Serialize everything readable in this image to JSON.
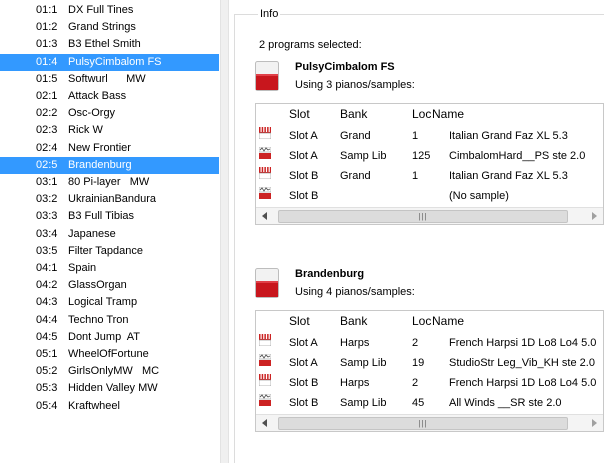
{
  "programs": [
    {
      "num": "01:1",
      "name": "DX Full Tines",
      "selected": false
    },
    {
      "num": "01:2",
      "name": "Grand Strings",
      "selected": false
    },
    {
      "num": "01:3",
      "name": "B3 Ethel Smith",
      "selected": false
    },
    {
      "num": "01:4",
      "name": "PulsyCimbalom FS",
      "selected": true
    },
    {
      "num": "01:5",
      "name": "Softwurl      MW",
      "selected": false
    },
    {
      "num": "02:1",
      "name": "Attack Bass",
      "selected": false
    },
    {
      "num": "02:2",
      "name": "Osc-Orgy",
      "selected": false
    },
    {
      "num": "02:3",
      "name": "Rick W",
      "selected": false
    },
    {
      "num": "02:4",
      "name": "New Frontier",
      "selected": false
    },
    {
      "num": "02:5",
      "name": "Brandenburg",
      "selected": true
    },
    {
      "num": "03:1",
      "name": "80 Pi-layer   MW",
      "selected": false
    },
    {
      "num": "03:2",
      "name": "UkrainianBandura",
      "selected": false
    },
    {
      "num": "03:3",
      "name": "B3 Full Tibias",
      "selected": false
    },
    {
      "num": "03:4",
      "name": "Japanese",
      "selected": false
    },
    {
      "num": "03:5",
      "name": "Filter Tapdance",
      "selected": false
    },
    {
      "num": "04:1",
      "name": "Spain",
      "selected": false
    },
    {
      "num": "04:2",
      "name": "GlassOrgan",
      "selected": false
    },
    {
      "num": "04:3",
      "name": "Logical Tramp",
      "selected": false
    },
    {
      "num": "04:4",
      "name": "Techno Tron",
      "selected": false
    },
    {
      "num": "04:5",
      "name": "Dont Jump  AT",
      "selected": false
    },
    {
      "num": "05:1",
      "name": "WheelOfFortune",
      "selected": false
    },
    {
      "num": "05:2",
      "name": "GirlsOnlyMW   MC",
      "selected": false
    },
    {
      "num": "05:3",
      "name": "Hidden Valley MW",
      "selected": false
    },
    {
      "num": "05:4",
      "name": "Kraftwheel",
      "selected": false
    }
  ],
  "info": {
    "title": "Info",
    "selected_count": "2 programs selected:",
    "columns": {
      "slot": "Slot",
      "bank": "Bank",
      "loc": "Loc",
      "name": "Name"
    },
    "blocks": [
      {
        "title": "PulsyCimbalom FS",
        "subtitle": "Using 3 pianos/samples:",
        "rows": [
          {
            "icon": "piano-icon",
            "slot": "Slot A",
            "bank": "Grand",
            "loc": "1",
            "name": "Italian Grand Faz XL 5.3"
          },
          {
            "icon": "sample-icon",
            "slot": "Slot A",
            "bank": "Samp Lib",
            "loc": "125",
            "name": "CimbalomHard__PS ste 2.0"
          },
          {
            "icon": "piano-icon",
            "slot": "Slot B",
            "bank": "Grand",
            "loc": "1",
            "name": "Italian Grand Faz XL 5.3"
          },
          {
            "icon": "sample-icon",
            "slot": "Slot B",
            "bank": "",
            "loc": "",
            "name": "(No sample)"
          }
        ]
      },
      {
        "title": "Brandenburg",
        "subtitle": "Using 4 pianos/samples:",
        "rows": [
          {
            "icon": "piano-icon",
            "slot": "Slot A",
            "bank": "Harps",
            "loc": "2",
            "name": "French Harpsi 1D Lo8 Lo4 5.0"
          },
          {
            "icon": "sample-icon",
            "slot": "Slot A",
            "bank": "Samp Lib",
            "loc": "19",
            "name": "StudioStr Leg_Vib_KH ste 2.0"
          },
          {
            "icon": "piano-icon",
            "slot": "Slot B",
            "bank": "Harps",
            "loc": "2",
            "name": "French Harpsi 1D Lo8 Lo4 5.0"
          },
          {
            "icon": "sample-icon",
            "slot": "Slot B",
            "bank": "Samp Lib",
            "loc": "45",
            "name": "All Winds __SR ste 2.0"
          }
        ]
      }
    ]
  },
  "colors": {
    "selection": "#3399ff",
    "program_icon_red": "#c8161d"
  }
}
